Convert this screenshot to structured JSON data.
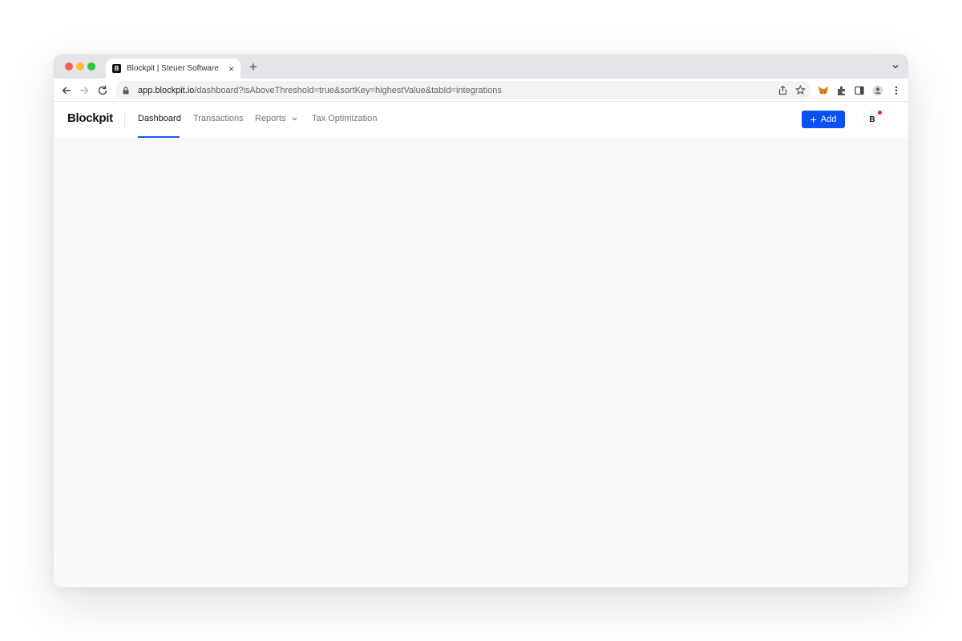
{
  "browser": {
    "tab": {
      "favicon_letter": "B",
      "title": "Blockpit | Steuer Software für",
      "close_symbol": "×"
    },
    "new_tab_symbol": "+",
    "url": {
      "host": "app.blockpit.io",
      "path": "/dashboard?isAboveThreshold=true&sortKey=highestValue&tabId=integrations"
    },
    "icons": [
      "back-icon",
      "forward-icon",
      "reload-icon",
      "lock-icon",
      "share-icon",
      "star-icon",
      "metamask-icon",
      "extensions-icon",
      "sidepanel-icon",
      "profile-icon",
      "menu-icon",
      "tab-search-icon"
    ],
    "traffic_colors": {
      "close": "#ff5f57",
      "minimize": "#febc2e",
      "zoom": "#28c840"
    }
  },
  "app": {
    "logo": "Blockpit",
    "nav": {
      "dashboard": "Dashboard",
      "transactions": "Transactions",
      "reports": "Reports",
      "tax_optimization": "Tax Optimization"
    },
    "active_nav": "dashboard",
    "add_button": {
      "label": "Add",
      "icon": "+"
    },
    "avatar_letter": "B",
    "colors": {
      "accent": "#0b50f5",
      "notification": "#e5231b",
      "background": "#f7f9fb"
    }
  }
}
